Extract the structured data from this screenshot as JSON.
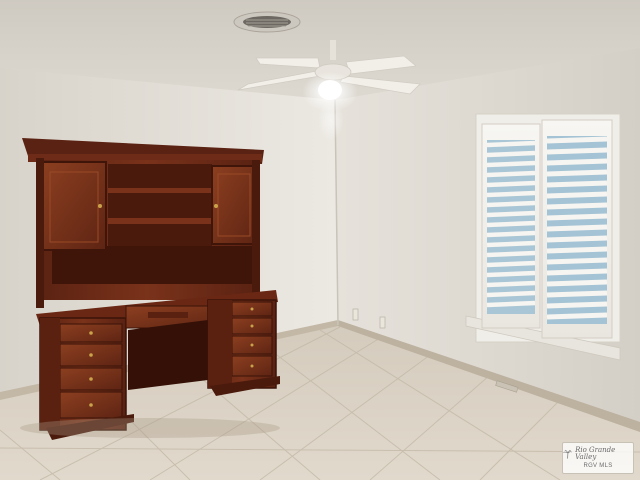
{
  "watermark": {
    "brand": "Rio Grande Valley",
    "sub": "RGV MLS"
  },
  "colors": {
    "ceiling": "#d3cec5",
    "wall_left": "#e4e0d8",
    "wall_right": "#dcd8d0",
    "floor": "#d8cfc1",
    "wood_dark": "#4a1c0f",
    "wood_mid": "#6a2a16",
    "wood_light": "#8a3d1f",
    "shutter": "#f4f2ee",
    "baseboard": "#bfb4a3"
  },
  "icons": {
    "fan": "ceiling-fan-icon",
    "vent": "air-vent-icon",
    "palm": "palm-tree-icon"
  }
}
